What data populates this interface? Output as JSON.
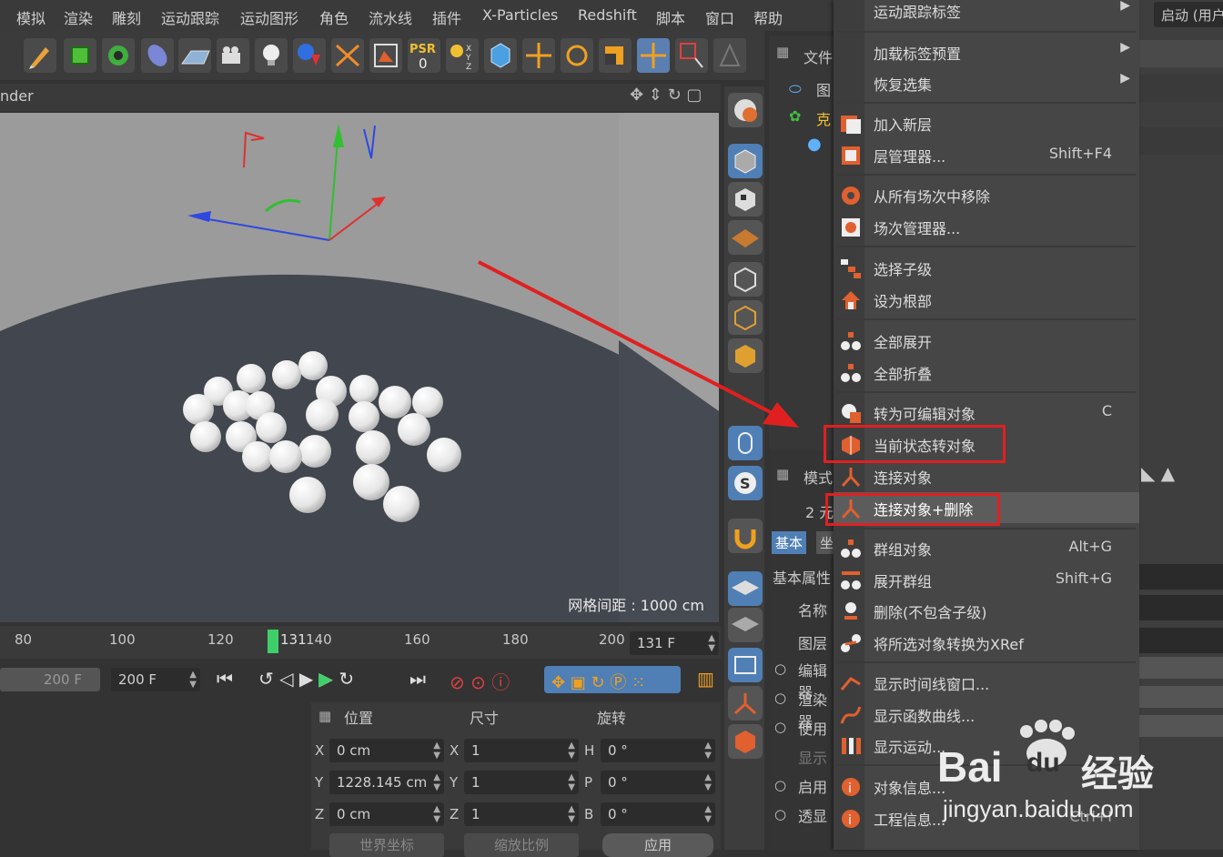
{
  "menubar": [
    "模拟",
    "渲染",
    "雕刻",
    "运动跟踪",
    "运动图形",
    "角色",
    "流水线",
    "插件",
    "X-Particles",
    "Redshift",
    "脚本",
    "窗口",
    "帮助"
  ],
  "viewport": {
    "header_text": "nder",
    "grid_label": "网格间距 : 1000 cm"
  },
  "objmgr": {
    "header": "文件",
    "rows": [
      "图",
      "克"
    ]
  },
  "attrmgr": {
    "mode_label": "模式",
    "count_label": "2 元",
    "tabs": [
      "基本",
      "坐"
    ],
    "section": "基本属性",
    "rows": [
      "名称",
      "图层",
      "编辑器",
      "渲染器",
      "使用",
      "显示",
      "启用",
      "透显"
    ]
  },
  "timeline": {
    "ticks": [
      "80",
      "100",
      "120",
      "131",
      "140",
      "160",
      "180",
      "200"
    ],
    "current_frame": "131 F"
  },
  "transport": {
    "end_field_left": "200 F",
    "end_field": "200 F"
  },
  "coords": {
    "headers": [
      "位置",
      "尺寸",
      "旋转"
    ],
    "rows": [
      {
        "axis": "X",
        "pos": "0 cm",
        "size_axis": "X",
        "size": "1",
        "rot_axis": "H",
        "rot": "0 °"
      },
      {
        "axis": "Y",
        "pos": "1228.145 cm",
        "size_axis": "Y",
        "size": "1",
        "rot_axis": "P",
        "rot": "0 °"
      },
      {
        "axis": "Z",
        "pos": "0 cm",
        "size_axis": "Z",
        "size": "1",
        "rot_axis": "B",
        "rot": "0 °"
      }
    ],
    "footer": [
      "世界坐标",
      "缩放比例",
      "应用"
    ]
  },
  "context_menu": {
    "items": [
      {
        "label": "运动跟踪标签",
        "shortcut": "",
        "submenu": true
      },
      {
        "label": "加载标签预置",
        "shortcut": "",
        "submenu": true
      },
      {
        "label": "恢复选集",
        "shortcut": "",
        "submenu": true
      },
      {
        "label": "加入新层",
        "shortcut": ""
      },
      {
        "label": "层管理器...",
        "shortcut": "Shift+F4"
      },
      {
        "label": "从所有场次中移除",
        "shortcut": ""
      },
      {
        "label": "场次管理器...",
        "shortcut": ""
      },
      {
        "label": "选择子级",
        "shortcut": ""
      },
      {
        "label": "设为根部",
        "shortcut": ""
      },
      {
        "label": "全部展开",
        "shortcut": ""
      },
      {
        "label": "全部折叠",
        "shortcut": ""
      },
      {
        "label": "转为可编辑对象",
        "shortcut": "C"
      },
      {
        "label": "当前状态转对象",
        "shortcut": ""
      },
      {
        "label": "连接对象",
        "shortcut": ""
      },
      {
        "label": "连接对象+删除",
        "shortcut": ""
      },
      {
        "label": "群组对象",
        "shortcut": "Alt+G"
      },
      {
        "label": "展开群组",
        "shortcut": "Shift+G"
      },
      {
        "label": "删除(不包含子级)",
        "shortcut": ""
      },
      {
        "label": "将所选对象转换为XRef",
        "shortcut": ""
      },
      {
        "label": "显示时间线窗口...",
        "shortcut": ""
      },
      {
        "label": "显示函数曲线...",
        "shortcut": ""
      },
      {
        "label": "显示运动...",
        "shortcut": ""
      },
      {
        "label": "对象信息...",
        "shortcut": ""
      },
      {
        "label": "工程信息...",
        "shortcut": "Ctrl+I"
      }
    ]
  },
  "rightstrip": {
    "button": "启动 (用户"
  },
  "watermark": {
    "brand": "Bai",
    "brand2": "du",
    "suffix": "经验",
    "url": "jingyan.baidu.com"
  },
  "colors": {
    "highlight": "#e02020",
    "menu_bg": "#464646",
    "menu_hover": "#5a5a5a"
  }
}
